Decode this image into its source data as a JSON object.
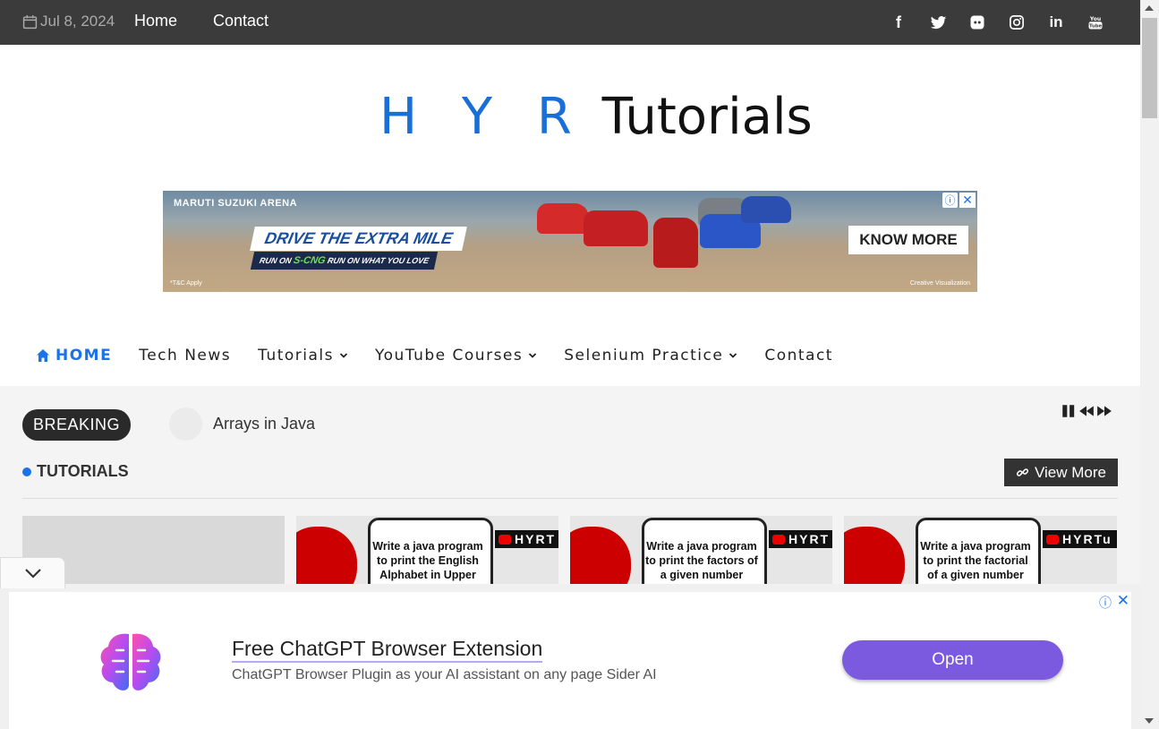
{
  "topbar": {
    "date": "Jul 8, 2024",
    "nav": [
      "Home",
      "Contact"
    ],
    "socials": [
      "facebook-icon",
      "twitter-icon",
      "discord-icon",
      "instagram-icon",
      "linkedin-icon",
      "youtube-icon"
    ]
  },
  "logo": {
    "part1": "H Y R",
    "part2": " Tutorials"
  },
  "ad_banner": {
    "brand": "MARUTI SUZUKI ARENA",
    "tagline": "DRIVE THE EXTRA MILE",
    "sub_left": "RUN ON",
    "sub_cng": "S-CNG",
    "sub_right": "RUN ON WHAT YOU LOVE",
    "cta": "KNOW MORE",
    "terms": "*T&C Apply",
    "credit": "Creative Visualization"
  },
  "mainnav": {
    "home": "HOME",
    "items": [
      "Tech News",
      "Tutorials",
      "YouTube Courses",
      "Selenium Practice",
      "Contact"
    ]
  },
  "breaking": {
    "label": "BREAKING",
    "headline": "Arrays in Java"
  },
  "tutorials": {
    "heading": "TUTORIALS",
    "view_more": "View More",
    "cards": [
      {
        "text": ""
      },
      {
        "text": "Write a java program to print the English Alphabet in Upper",
        "badge": "HYRT"
      },
      {
        "text": "Write a java program to print the factors of a given number",
        "badge": "HYRT"
      },
      {
        "text": "Write a java program to print the factorial of a given number",
        "badge": "HYRTu"
      }
    ]
  },
  "bottom_ad": {
    "title": "Free ChatGPT Browser Extension",
    "description": "ChatGPT Browser Plugin as your AI assistant on any page Sider AI",
    "button": "Open"
  },
  "colors": {
    "accent": "#1a73e8",
    "topbar": "#3b3b3b",
    "open_button": "#7b5ae0"
  }
}
